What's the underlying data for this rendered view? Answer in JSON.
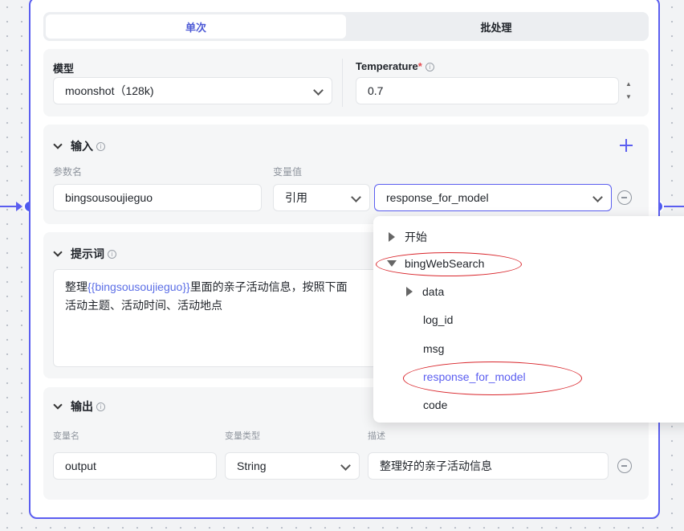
{
  "tabs": [
    {
      "label": "单次",
      "active": true
    },
    {
      "label": "批处理",
      "active": false
    }
  ],
  "model": {
    "label": "模型",
    "value": "moonshot（128k)"
  },
  "temperature": {
    "label": "Temperature",
    "required_mark": "*",
    "value": "0.7"
  },
  "input": {
    "title": "输入",
    "param_header": "参数名",
    "value_header": "变量值",
    "param_name": "bingsousoujieguo",
    "value_type": "引用",
    "value_ref": "response_for_model"
  },
  "prompt": {
    "title": "提示词",
    "text_before": "整理",
    "variable": "{{bingsousoujieguo}}",
    "text_after": "里面的亲子活动信息，按照下面",
    "line2": "活动主题、活动时间、活动地点"
  },
  "output": {
    "title": "输出",
    "name_header": "变量名",
    "type_header": "变量类型",
    "desc_header": "描述",
    "name": "output",
    "type": "String",
    "desc": "整理好的亲子活动信息"
  },
  "dropdown": {
    "items": [
      {
        "label": "开始",
        "kind": "collapsed"
      },
      {
        "label": "bingWebSearch",
        "kind": "expanded"
      },
      {
        "label": "data",
        "kind": "collapsed"
      },
      {
        "label": "log_id",
        "kind": "leaf"
      },
      {
        "label": "msg",
        "kind": "leaf"
      },
      {
        "label": "response_for_model",
        "kind": "selected"
      },
      {
        "label": "code",
        "kind": "leaf"
      }
    ]
  },
  "colors": {
    "accent": "#5b5ef0",
    "annotation": "#d9262c",
    "variable": "#5b6ee6"
  },
  "icons": {
    "info": "ⓘ",
    "spinner_up": "▲",
    "spinner_down": "▼"
  }
}
